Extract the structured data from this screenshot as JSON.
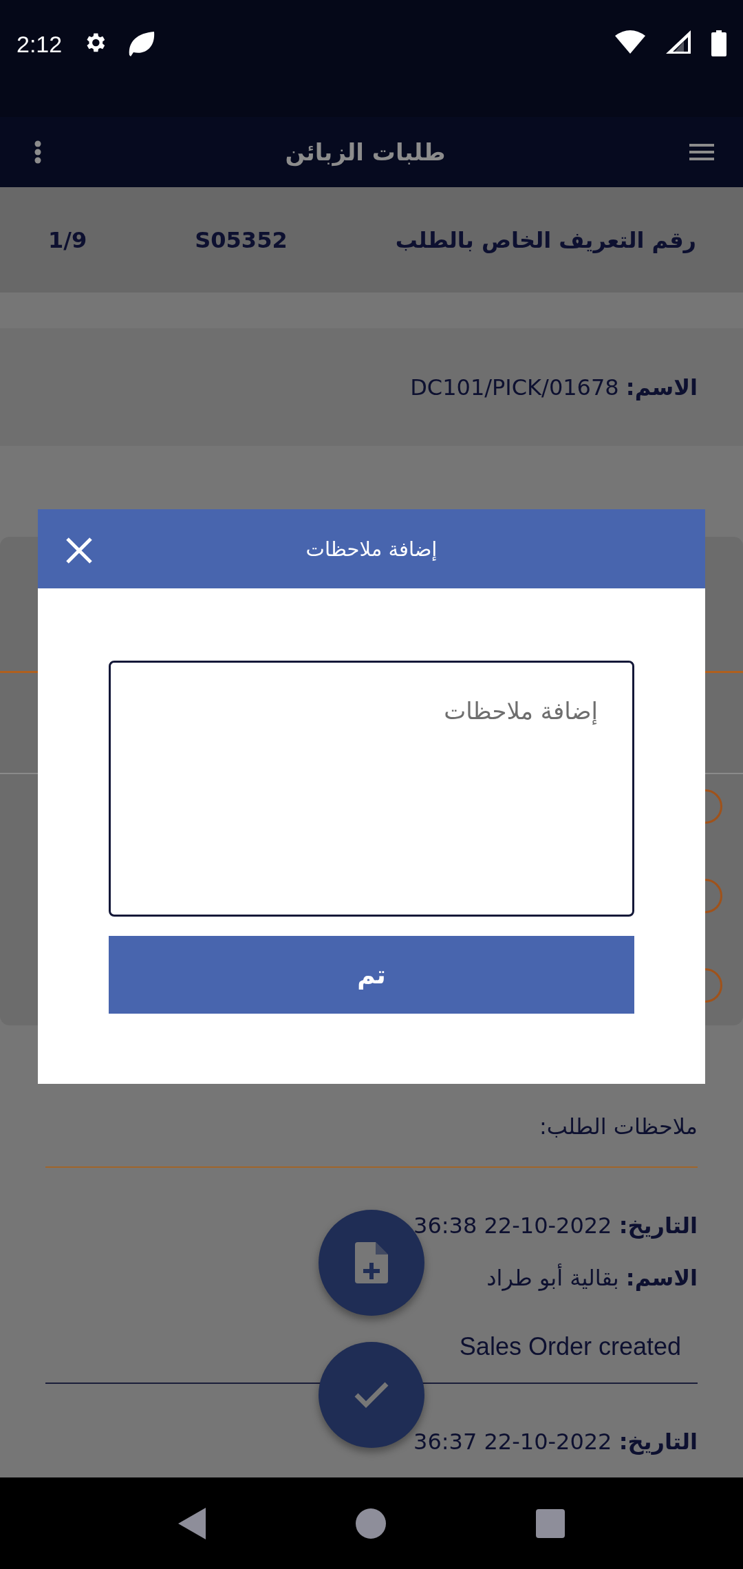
{
  "status_bar": {
    "time": "2:12"
  },
  "app_bar": {
    "title": "طلبات الزبائن"
  },
  "order_header": {
    "label": "رقم التعريف الخاص بالطلب",
    "order_id": "S05352",
    "position": "1/9"
  },
  "name_card": {
    "label": "الاسم:",
    "value": "DC101/PICK/01678"
  },
  "hidden_card": {
    "options": [
      {
        "selected": false
      },
      {
        "selected": false
      },
      {
        "selected": false
      }
    ]
  },
  "order_notes": {
    "label": "ملاحظات الطلب:",
    "entries": [
      {
        "date_label": "التاريخ:",
        "date": "36:38 22-10-2022",
        "name_label": "الاسم:",
        "name": "بقالية أبو طراد",
        "message": "Sales Order created"
      },
      {
        "date_label": "التاريخ:",
        "date": "36:37 22-10-2022"
      }
    ]
  },
  "fabs": [
    {
      "kind": "add_file"
    },
    {
      "kind": "confirm"
    }
  ],
  "dialog": {
    "title": "إضافة ملاحظات",
    "notes_field": {
      "placeholder": "إضافة ملاحظات"
    },
    "button": "تم"
  }
}
